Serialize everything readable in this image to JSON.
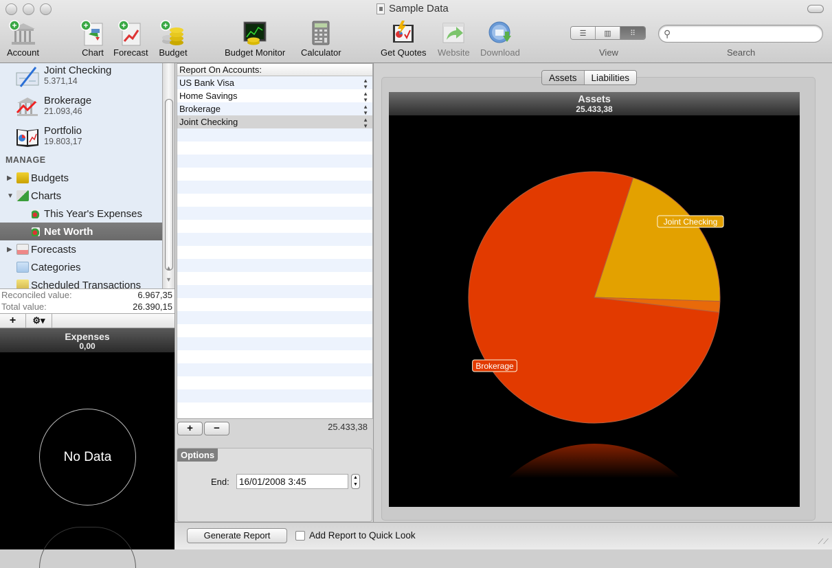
{
  "window": {
    "title": "Sample Data"
  },
  "toolbar": {
    "items": [
      {
        "label": "Account",
        "icon": "add-account-icon"
      },
      {
        "label": "Chart",
        "icon": "add-chart-icon"
      },
      {
        "label": "Forecast",
        "icon": "add-forecast-icon"
      },
      {
        "label": "Budget",
        "icon": "add-budget-icon"
      },
      {
        "label": "Budget Monitor",
        "icon": "budget-monitor-icon"
      },
      {
        "label": "Calculator",
        "icon": "calculator-icon"
      },
      {
        "label": "Get Quotes",
        "icon": "get-quotes-icon"
      },
      {
        "label": "Website",
        "icon": "website-icon"
      },
      {
        "label": "Download",
        "icon": "download-icon"
      }
    ],
    "view_label": "View",
    "view_options": [
      "list",
      "cover-flow",
      "grid"
    ],
    "view_selected": "grid",
    "search_label": "Search",
    "search_value": ""
  },
  "sidebar": {
    "accounts": [
      {
        "name": "Joint Checking",
        "value": "5.371,14"
      },
      {
        "name": "Brokerage",
        "value": "21.093,46"
      },
      {
        "name": "Portfolio",
        "value": "19.803,17"
      }
    ],
    "section": "MANAGE",
    "tree": [
      {
        "label": "Budgets",
        "expander": "▶",
        "level": 0
      },
      {
        "label": "Charts",
        "expander": "▼",
        "level": 0
      },
      {
        "label": "This Year's Expenses",
        "expander": "",
        "level": 1
      },
      {
        "label": "Net Worth",
        "expander": "",
        "level": 1,
        "selected": true
      },
      {
        "label": "Forecasts",
        "expander": "▶",
        "level": 0
      },
      {
        "label": "Categories",
        "expander": "",
        "level": 0
      },
      {
        "label": "Scheduled Transactions",
        "expander": "",
        "level": 0
      }
    ],
    "reconciled_label": "Reconciled value:",
    "reconciled_value": "6.967,35",
    "total_label": "Total value:",
    "total_value": "26.390,15",
    "add_button": "+",
    "gear_button": "⚙▾",
    "mini_chart": {
      "title": "Expenses",
      "value": "0,00",
      "empty_text": "No Data"
    }
  },
  "report": {
    "header": "Report On Accounts:",
    "accounts": [
      "US Bank Visa",
      "Home Savings",
      "Brokerage",
      "Joint Checking"
    ],
    "selected_index": 3,
    "add_label": "+",
    "remove_label": "−",
    "total": "25.433,38",
    "options_label": "Options",
    "end_label": "End:",
    "end_value": "16/01/2008   3:45",
    "generate_label": "Generate Report",
    "quicklook_label": "Add Report to Quick Look",
    "quicklook_checked": false
  },
  "chart_tabs": {
    "items": [
      "Assets",
      "Liabilities"
    ],
    "selected": "Assets"
  },
  "chart_data": {
    "type": "pie",
    "title": "Assets",
    "subtitle": "25.433,38",
    "slices": [
      {
        "label": "Joint Checking",
        "percent": 20.5,
        "color": "#e3a100",
        "show_label": true
      },
      {
        "label": "Home Savings",
        "percent": 1.4,
        "color": "#e86a0a",
        "show_label": false
      },
      {
        "label": "Brokerage",
        "percent": 78.1,
        "color": "#e23a00",
        "show_label": true
      }
    ],
    "start_angle_deg": 72,
    "direction": "clockwise",
    "reflection": true
  }
}
